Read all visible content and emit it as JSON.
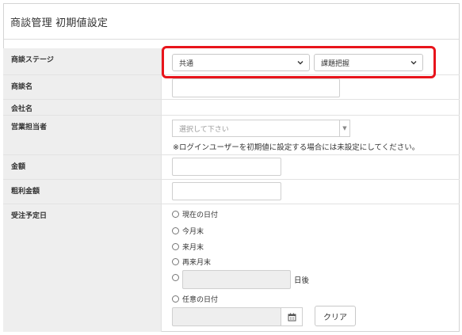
{
  "header": {
    "title": "商談管理 初期値設定"
  },
  "fields": {
    "stage": {
      "label": "商談ステージ",
      "select1_value": "共通",
      "select2_value": "課題把握"
    },
    "deal_name": {
      "label": "商談名",
      "value": ""
    },
    "company": {
      "label": "会社名"
    },
    "sales_rep": {
      "label": "営業担当者",
      "placeholder": "選択して下さい",
      "note": "※ログインユーザーを初期値に設定する場合には未設定にしてください。"
    },
    "amount": {
      "label": "金額",
      "value": ""
    },
    "gross_profit": {
      "label": "粗利金額",
      "value": ""
    },
    "order_date": {
      "label": "受注予定日",
      "options": [
        "現在の日付",
        "今月末",
        "来月末",
        "再来月末",
        "",
        "任意の日付"
      ],
      "days_after_label": "日後",
      "clear_button": "クリア"
    }
  },
  "icons": {
    "calendar": "calendar-icon",
    "chevron": "chevron-down-icon"
  },
  "colors": {
    "highlight": "#e8141b",
    "label_bg": "#eeeeee"
  }
}
